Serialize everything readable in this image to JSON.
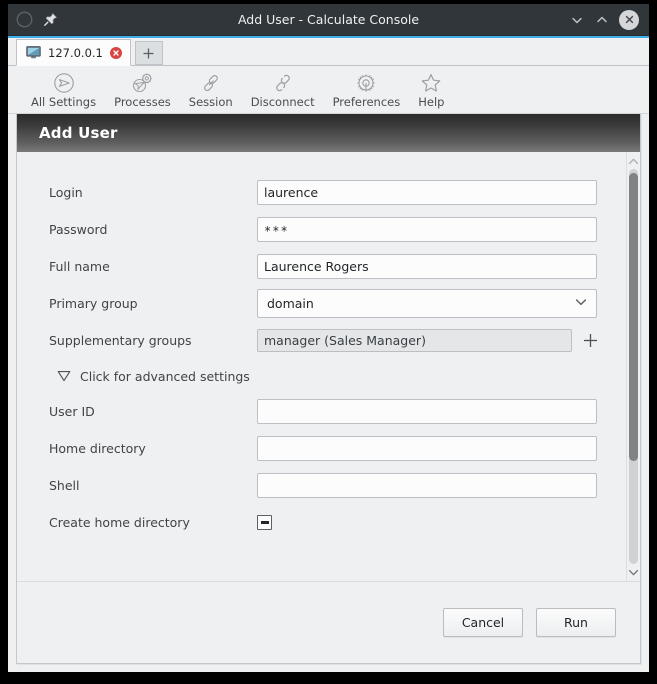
{
  "window": {
    "title": "Add User - Calculate Console",
    "logo_icon": "calculate-logo-icon",
    "pin_icon": "pin-icon",
    "minimize_icon": "chevron-down-icon",
    "maximize_icon": "chevron-up-icon",
    "close_icon": "close-icon",
    "titlebar_color": "#31363b",
    "accent_color": "#3daee9"
  },
  "tabs": {
    "items": [
      {
        "label": "127.0.0.1",
        "icon": "monitor-icon",
        "close_icon": "tab-close-icon"
      }
    ],
    "new_tab_label": "+"
  },
  "toolbar": {
    "items": [
      {
        "label": "All Settings",
        "icon": "all-settings-icon"
      },
      {
        "label": "Processes",
        "icon": "processes-icon"
      },
      {
        "label": "Session",
        "icon": "session-icon"
      },
      {
        "label": "Disconnect",
        "icon": "disconnect-icon"
      },
      {
        "label": "Preferences",
        "icon": "preferences-icon"
      },
      {
        "label": "Help",
        "icon": "help-star-icon"
      }
    ]
  },
  "page": {
    "heading": "Add User"
  },
  "form": {
    "login": {
      "label": "Login",
      "value": "laurence",
      "placeholder": ""
    },
    "password": {
      "label": "Password",
      "value": "***",
      "placeholder": ""
    },
    "full_name": {
      "label": "Full name",
      "value": "Laurence Rogers",
      "placeholder": ""
    },
    "primary_group": {
      "label": "Primary group",
      "value": "domain",
      "dropdown_icon": "chevron-down-icon"
    },
    "supplementary": {
      "label": "Supplementary groups",
      "value": "manager (Sales Manager)",
      "add_icon": "plus-icon"
    },
    "advanced": {
      "label": "Click for advanced settings",
      "icon": "triangle-down-icon"
    },
    "user_id": {
      "label": "User ID",
      "value": "",
      "placeholder": ""
    },
    "home_dir": {
      "label": "Home directory",
      "value": "",
      "placeholder": ""
    },
    "shell": {
      "label": "Shell",
      "value": "",
      "placeholder": ""
    },
    "create_home": {
      "label": "Create home directory",
      "state": "indeterminate"
    }
  },
  "footer": {
    "cancel_label": "Cancel",
    "run_label": "Run"
  },
  "scrollbar": {
    "up_icon": "chevron-up-icon",
    "down_icon": "chevron-down-icon",
    "thumb_position_percent": 1,
    "thumb_size_percent": 73
  }
}
